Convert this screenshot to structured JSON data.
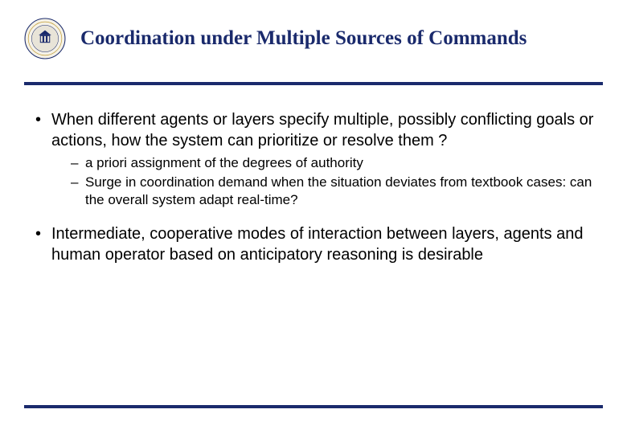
{
  "title": "Coordination under Multiple Sources of Commands",
  "colors": {
    "accent": "#1a2a6c"
  },
  "bullets": [
    {
      "text": "When different agents or layers specify multiple, possibly conflicting goals or actions, how the system can prioritize or resolve them ?",
      "sub": [
        "a priori assignment of the degrees of authority",
        "Surge in coordination demand when the situation deviates from textbook cases: can the overall system adapt real-time?"
      ]
    },
    {
      "text": "Intermediate, cooperative modes of interaction between layers, agents and human operator based on anticipatory reasoning is desirable",
      "sub": []
    }
  ]
}
